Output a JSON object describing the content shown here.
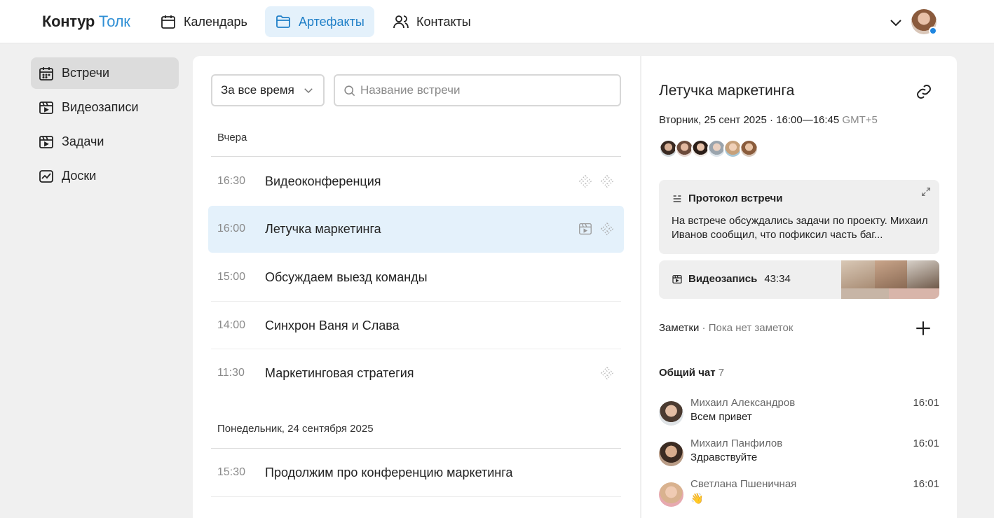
{
  "header": {
    "logo_part1": "Контур",
    "logo_part2": "Толк",
    "nav": [
      {
        "label": "Календарь",
        "icon": "calendar-icon",
        "active": false
      },
      {
        "label": "Артефакты",
        "icon": "folder-icon",
        "active": true
      },
      {
        "label": "Контакты",
        "icon": "contacts-icon",
        "active": false
      }
    ],
    "status_color": "#1f86e0"
  },
  "sidebar": {
    "items": [
      {
        "label": "Встречи",
        "icon": "calendar-grid-icon",
        "active": true
      },
      {
        "label": "Видеозаписи",
        "icon": "video-recording-icon",
        "active": false
      },
      {
        "label": "Задачи",
        "icon": "tasks-icon",
        "active": false
      },
      {
        "label": "Доски",
        "icon": "whiteboard-icon",
        "active": false
      }
    ]
  },
  "main": {
    "filter_value": "За все время",
    "search_placeholder": "Название встречи",
    "groups": [
      {
        "heading": "Вчера",
        "meetings": [
          {
            "time": "16:30",
            "title": "Видеоконференция",
            "icons": [
              "summary-icon",
              "summary-icon"
            ],
            "selected": false
          },
          {
            "time": "16:00",
            "title": "Летучка маркетинга",
            "icons": [
              "video-recording-icon",
              "summary-icon"
            ],
            "selected": true
          },
          {
            "time": "15:00",
            "title": "Обсуждаем выезд команды",
            "icons": [],
            "selected": false
          },
          {
            "time": "14:00",
            "title": "Синхрон Ваня и Слава",
            "icons": [],
            "selected": false
          },
          {
            "time": "11:30",
            "title": "Маркетинговая стратегия",
            "icons": [
              "summary-icon"
            ],
            "selected": false
          }
        ]
      },
      {
        "heading": "Понедельник, 24 сентября 2025",
        "meetings": [
          {
            "time": "15:30",
            "title": "Продолжим про конференцию маркетинга",
            "icons": [],
            "selected": false
          }
        ]
      }
    ]
  },
  "detail": {
    "title": "Летучка маркетинга",
    "date": "Вторник, 25 сент 2025 · 16:00—16:45",
    "timezone": "GMT+5",
    "protocol": {
      "heading": "Протокол встречи",
      "text": "На встрече обсуждались задачи по проекту. Михаил Иванов сообщил, что пофиксил часть баг..."
    },
    "video": {
      "label": "Видеозапись",
      "duration": "43:34"
    },
    "notes": {
      "label": "Заметки",
      "empty": "Пока нет заметок"
    },
    "chat": {
      "label": "Общий чат",
      "count": "7",
      "messages": [
        {
          "name": "Михаил Александров",
          "text": "Всем привет",
          "time": "16:01"
        },
        {
          "name": "Михаил Панфилов",
          "text": "Здравствуйте",
          "time": "16:01"
        },
        {
          "name": "Светлана Пшеничная",
          "text": "👋",
          "time": "16:01"
        }
      ]
    }
  }
}
